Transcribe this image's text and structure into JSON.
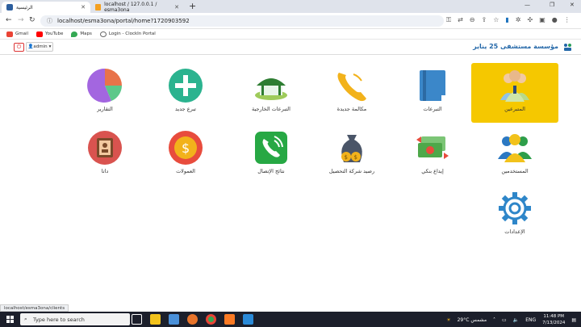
{
  "browser": {
    "tabs": [
      {
        "label": "الرئيسية"
      },
      {
        "label": "localhost / 127.0.0.1 / esma3ona"
      }
    ],
    "url": "localhost/esma3ona/portal/home?1720903592",
    "bookmarks": [
      {
        "label": "Gmail",
        "color": "#ea4335"
      },
      {
        "label": "YouTube",
        "color": "#ff0000"
      },
      {
        "label": "Maps",
        "color": "#34a853"
      },
      {
        "label": "Login - ClockIn Portal",
        "color": "#555555"
      }
    ]
  },
  "header": {
    "brand": "مؤسسة مستشفى 25 يناير",
    "user": "admin",
    "power_icon": "power-icon"
  },
  "tiles": [
    {
      "label": "المتبرعين",
      "icon": "donors-people-icon",
      "highlight": true
    },
    {
      "label": "التبرعات",
      "icon": "book-icon"
    },
    {
      "label": "مكالمة جديدة",
      "icon": "phone-icon"
    },
    {
      "label": "التبرعات الخارجية",
      "icon": "external-tent-icon"
    },
    {
      "label": "تبرع جديد",
      "icon": "plus-icon"
    },
    {
      "label": "التقارير",
      "icon": "pie-chart-icon"
    },
    {
      "label": "المستخدمين",
      "icon": "users-icon"
    },
    {
      "label": "إيداع بنكي",
      "icon": "bank-deposit-icon"
    },
    {
      "label": "رصيد شركة التحصيل",
      "icon": "money-bag-icon"
    },
    {
      "label": "نتائج الإتصال",
      "icon": "call-results-icon"
    },
    {
      "label": "العمولات",
      "icon": "coin-icon"
    },
    {
      "label": "داتا",
      "icon": "address-book-icon"
    },
    {
      "label": "الإعدادات",
      "icon": "settings-gear-icon"
    }
  ],
  "status_url": "localhost/esma3ona/clients",
  "taskbar": {
    "search_placeholder": "Type here to search",
    "weather": "29°C  مشمس",
    "lang": "ENG",
    "time": "11:48 PM",
    "date": "7/13/2024"
  },
  "colors": {
    "highlight": "#f5c800",
    "brand": "#2367a8",
    "taskbar": "#1c1f2b"
  }
}
